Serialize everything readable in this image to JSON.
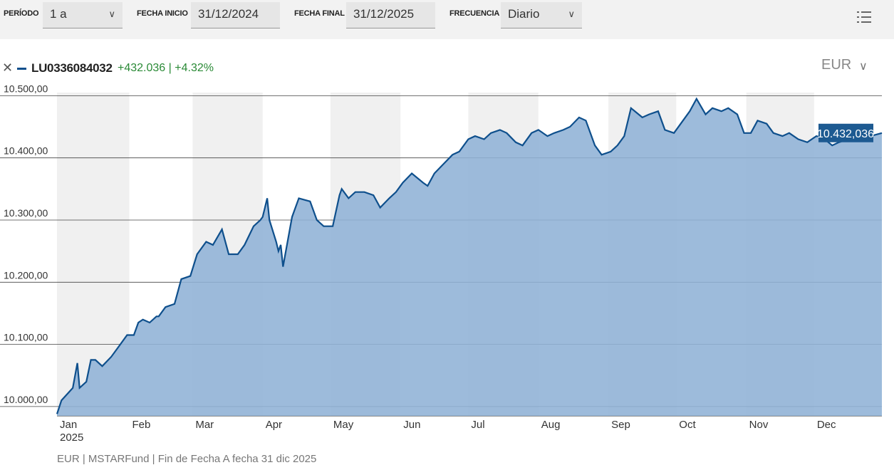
{
  "toolbar": {
    "period_label": "PERÍODO",
    "period_value": "1 a",
    "start_label": "FECHA INICIO",
    "start_value": "31/12/2024",
    "end_label": "FECHA FINAL",
    "end_value": "31/12/2025",
    "freq_label": "FRECUENCIA",
    "freq_value": "Diario"
  },
  "legend": {
    "ticker": "LU0336084032",
    "change_abs": "+432.036",
    "separator": "|",
    "change_pct": "+4.32%",
    "series_color": "#0e4f8c",
    "positive_color": "#2a8a36"
  },
  "currency": {
    "value": "EUR"
  },
  "icons": [
    "chevron-down-icon",
    "close-icon",
    "list-menu-icon"
  ],
  "chart_data": {
    "type": "area",
    "ylim": [
      9985,
      10505
    ],
    "yticks": [
      10000,
      10100,
      10200,
      10300,
      10400,
      10500
    ],
    "ytick_labels": [
      "10.000,00",
      "10.100,00",
      "10.200,00",
      "10.300,00",
      "10.400,00",
      "10.500,00"
    ],
    "months": [
      "Jan",
      "Feb",
      "Mar",
      "Apr",
      "May",
      "Jun",
      "Jul",
      "Aug",
      "Sep",
      "Oct",
      "Nov",
      "Dec"
    ],
    "year_label": "2025",
    "grid": true,
    "fill_color": "#8fb2d6",
    "line_color": "#0e4f8c",
    "last_value_label": "10.432,036",
    "series": [
      {
        "x": [
          "2024-12-31",
          "2025-01-02",
          "2025-01-07",
          "2025-01-09",
          "2025-01-10",
          "2025-01-13",
          "2025-01-15",
          "2025-01-17",
          "2025-01-20",
          "2025-01-24",
          "2025-01-27",
          "2025-01-31",
          "2025-02-03",
          "2025-02-05",
          "2025-02-07",
          "2025-02-10",
          "2025-02-13",
          "2025-02-14",
          "2025-02-17",
          "2025-02-21",
          "2025-02-24",
          "2025-02-28",
          "2025-03-03",
          "2025-03-07",
          "2025-03-10",
          "2025-03-14",
          "2025-03-17",
          "2025-03-21",
          "2025-03-24",
          "2025-03-28",
          "2025-03-31",
          "2025-04-01",
          "2025-04-03",
          "2025-04-04",
          "2025-04-07",
          "2025-04-08",
          "2025-04-09",
          "2025-04-10",
          "2025-04-14",
          "2025-04-17",
          "2025-04-22",
          "2025-04-25",
          "2025-04-28",
          "2025-05-02",
          "2025-05-05",
          "2025-05-06",
          "2025-05-09",
          "2025-05-12",
          "2025-05-16",
          "2025-05-20",
          "2025-05-23",
          "2025-05-27",
          "2025-05-30",
          "2025-06-02",
          "2025-06-06",
          "2025-06-11",
          "2025-06-13",
          "2025-06-16",
          "2025-06-20",
          "2025-06-24",
          "2025-06-27",
          "2025-07-01",
          "2025-07-04",
          "2025-07-08",
          "2025-07-11",
          "2025-07-15",
          "2025-07-18",
          "2025-07-22",
          "2025-07-25",
          "2025-07-29",
          "2025-08-01",
          "2025-08-05",
          "2025-08-08",
          "2025-08-12",
          "2025-08-15",
          "2025-08-19",
          "2025-08-22",
          "2025-08-26",
          "2025-08-29",
          "2025-09-02",
          "2025-09-05",
          "2025-09-08",
          "2025-09-11",
          "2025-09-16",
          "2025-09-19",
          "2025-09-23",
          "2025-09-26",
          "2025-09-30",
          "2025-10-03",
          "2025-10-07",
          "2025-10-10",
          "2025-10-14",
          "2025-10-17",
          "2025-10-21",
          "2025-10-24",
          "2025-10-28",
          "2025-10-31",
          "2025-11-03",
          "2025-11-06",
          "2025-11-10",
          "2025-11-13",
          "2025-11-17",
          "2025-11-20",
          "2025-11-24",
          "2025-11-28",
          "2025-12-02",
          "2025-12-05",
          "2025-12-09",
          "2025-12-12",
          "2025-12-16",
          "2025-12-19",
          "2025-12-23",
          "2025-12-31"
        ],
        "y": [
          9988,
          10010,
          10030,
          10070,
          10030,
          10040,
          10075,
          10075,
          10065,
          10080,
          10095,
          10115,
          10115,
          10135,
          10140,
          10135,
          10145,
          10145,
          10160,
          10165,
          10205,
          10210,
          10245,
          10265,
          10260,
          10285,
          10245,
          10245,
          10260,
          10290,
          10300,
          10305,
          10335,
          10300,
          10265,
          10250,
          10260,
          10225,
          10305,
          10335,
          10330,
          10300,
          10290,
          10290,
          10340,
          10350,
          10335,
          10345,
          10345,
          10340,
          10320,
          10335,
          10345,
          10360,
          10375,
          10360,
          10355,
          10375,
          10390,
          10405,
          10410,
          10430,
          10435,
          10430,
          10440,
          10445,
          10440,
          10425,
          10420,
          10440,
          10445,
          10435,
          10440,
          10445,
          10450,
          10465,
          10460,
          10420,
          10405,
          10410,
          10420,
          10435,
          10480,
          10465,
          10470,
          10475,
          10445,
          10440,
          10455,
          10475,
          10495,
          10470,
          10480,
          10475,
          10480,
          10470,
          10440,
          10440,
          10460,
          10455,
          10440,
          10435,
          10440,
          10430,
          10425,
          10435,
          10432,
          10420,
          10425,
          10430,
          10432,
          10432,
          10440
        ]
      }
    ]
  },
  "footer": {
    "text": "EUR | MSTARFund | Fin de Fecha A fecha 31 dic 2025"
  }
}
